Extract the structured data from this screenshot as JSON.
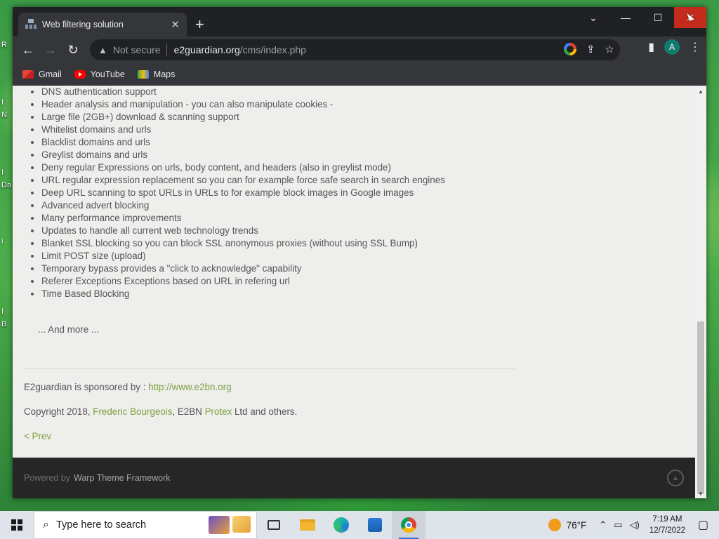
{
  "desktop": {
    "labels": [
      "R",
      "I",
      "N",
      "I",
      "Da",
      "i",
      "I",
      "B"
    ]
  },
  "browser": {
    "tab": {
      "title": "Web filtering solution",
      "favicon": "network-icon"
    },
    "new_tab_glyph": "+",
    "window_controls": {
      "menu": "⌄",
      "minimize": "—",
      "maximize": "☐",
      "close": "✕"
    },
    "address": {
      "security_label": "Not secure",
      "host": "e2guardian.org",
      "path": "/cms/index.php"
    },
    "profile_initial": "A",
    "bookmarks": [
      {
        "label": "Gmail",
        "icon": "gmail-icon"
      },
      {
        "label": "YouTube",
        "icon": "youtube-icon"
      },
      {
        "label": "Maps",
        "icon": "maps-icon"
      }
    ]
  },
  "page": {
    "features": [
      "DNS authentication support",
      "Header analysis and manipulation - you can also manipulate cookies -",
      "Large file (2GB+) download & scanning support",
      "Whitelist domains and urls",
      "Blacklist domains and urls",
      "Greylist domains and urls",
      "Deny regular Expressions on urls, body content, and headers (also in greylist mode)",
      "URL regular expression replacement so you can for example force safe search in search engines",
      "Deep URL scanning to spot URLs in URLs to for example block images in Google images",
      "Advanced advert blocking",
      "Many performance improvements",
      "Updates to handle all current web technology trends",
      "Blanket SSL blocking so you can block SSL anonymous proxies (without using SSL Bump)",
      "Limit POST size (upload)",
      "Temporary bypass provides a \"click to acknowledge\" capability",
      "Referer Exceptions Exceptions based on URL in refering url",
      "Time Based Blocking"
    ],
    "and_more": "... And more ...",
    "sponsor_text": "E2guardian is sponsored by : ",
    "sponsor_link": "http://www.e2bn.org",
    "copyright_prefix": "Copyright 2018, ",
    "copyright_author": "Frederic Bourgeois",
    "copyright_mid": ", E2BN ",
    "copyright_company": "Protex",
    "copyright_suffix": " Ltd and others.",
    "prev_link": "< Prev",
    "footer_prefix": "Powered by",
    "footer_framework": "Warp Theme Framework"
  },
  "taskbar": {
    "search_placeholder": "Type here to search",
    "weather": "76°F",
    "time": "7:19 AM",
    "date": "12/7/2022"
  }
}
